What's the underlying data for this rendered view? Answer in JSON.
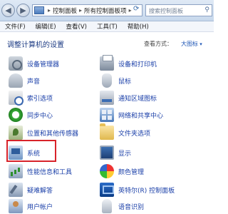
{
  "address_bar": {
    "breadcrumbs": [
      "控制面板",
      "所有控制面板项"
    ],
    "search_placeholder": "搜索控制面板"
  },
  "menu": [
    "文件(F)",
    "编辑(E)",
    "查看(V)",
    "工具(T)",
    "帮助(H)"
  ],
  "header": {
    "title": "调整计算机的设置",
    "view_by_label": "查看方式：",
    "view_by_value": "大图标"
  },
  "items": {
    "left": [
      {
        "label": "设备管理器",
        "icon": "device-manager-icon"
      },
      {
        "label": "声音",
        "icon": "sound-icon"
      },
      {
        "label": "索引选项",
        "icon": "indexing-icon"
      },
      {
        "label": "同步中心",
        "icon": "sync-center-icon"
      },
      {
        "label": "位置和其他传感器",
        "icon": "location-icon"
      },
      {
        "label": "系统",
        "icon": "system-icon"
      },
      {
        "label": "性能信息和工具",
        "icon": "performance-icon"
      },
      {
        "label": "疑难解答",
        "icon": "troubleshooting-icon"
      },
      {
        "label": "用户帐户",
        "icon": "user-accounts-icon"
      }
    ],
    "right": [
      {
        "label": "设备和打印机",
        "icon": "printer-icon"
      },
      {
        "label": "鼠标",
        "icon": "mouse-icon"
      },
      {
        "label": "通知区域图标",
        "icon": "notification-area-icon"
      },
      {
        "label": "网络和共享中心",
        "icon": "network-icon"
      },
      {
        "label": "文件夹选项",
        "icon": "folder-icon"
      },
      {
        "label": "显示",
        "icon": "display-icon"
      },
      {
        "label": "颜色管理",
        "icon": "color-management-icon"
      },
      {
        "label": "英特尔(R) 控制面板",
        "icon": "intel-icon"
      },
      {
        "label": "语音识别",
        "icon": "speech-icon"
      }
    ]
  },
  "colors": {
    "link": "#1a3fa8",
    "title": "#1e3c84",
    "highlight": "#d8232a"
  }
}
